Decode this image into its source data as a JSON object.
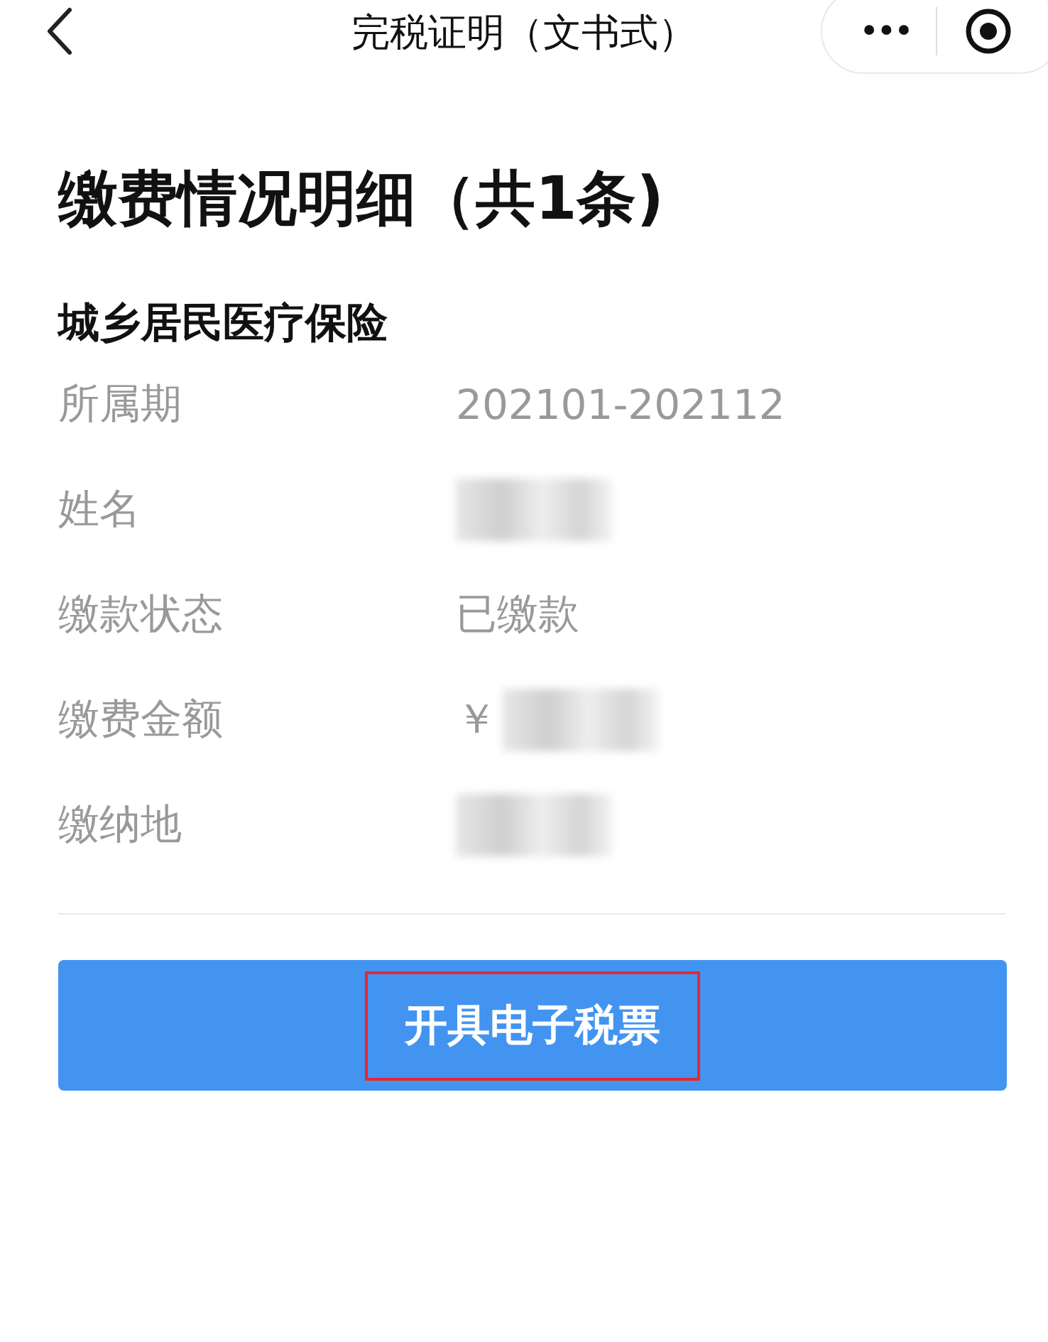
{
  "nav": {
    "title": "完税证明（文书式）",
    "more": "•••"
  },
  "heading": "缴费情况明细（共1条)",
  "section": "城乡居民医疗保险",
  "rows": [
    {
      "label": "所属期",
      "value": "202101-202112"
    },
    {
      "label": "姓名",
      "redacted": true
    },
    {
      "label": "缴款状态",
      "value": "已缴款"
    },
    {
      "label": "缴费金额",
      "value": "￥",
      "redacted": true
    },
    {
      "label": "缴纳地",
      "redacted": true
    }
  ],
  "button": {
    "label": "开具电子税票",
    "highlighted": true
  }
}
